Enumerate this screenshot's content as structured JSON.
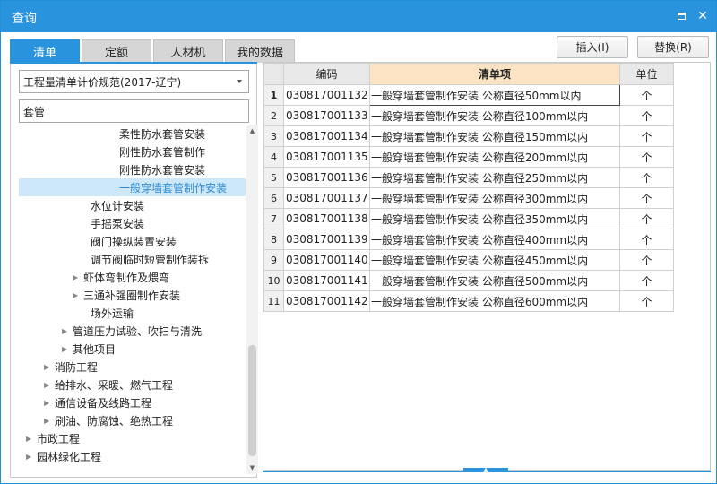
{
  "window": {
    "title": "查询"
  },
  "tabs": [
    {
      "label": "清单",
      "active": true
    },
    {
      "label": "定额",
      "active": false
    },
    {
      "label": "人材机",
      "active": false
    },
    {
      "label": "我的数据",
      "active": false
    }
  ],
  "actions": {
    "insert_label": "插入(I)",
    "replace_label": "替换(R)"
  },
  "left": {
    "spec_select": "工程量清单计价规范(2017-辽宁)",
    "search_value": "套管",
    "tree": [
      {
        "label": "柔性防水套管安装",
        "expandable": false,
        "selected": false
      },
      {
        "label": "刚性防水套管制作",
        "expandable": false,
        "selected": false
      },
      {
        "label": "刚性防水套管安装",
        "expandable": false,
        "selected": false
      },
      {
        "label": "一般穿墙套管制作安装",
        "expandable": false,
        "selected": true
      },
      {
        "label": "水位计安装",
        "expandable": false,
        "selected": false
      },
      {
        "label": "手摇泵安装",
        "expandable": false,
        "selected": false
      },
      {
        "label": "阀门操纵装置安装",
        "expandable": false,
        "selected": false
      },
      {
        "label": "调节阀临时短管制作装拆",
        "expandable": false,
        "selected": false
      },
      {
        "label": "虾体弯制作及煨弯",
        "expandable": true,
        "selected": false
      },
      {
        "label": "三通补强圈制作安装",
        "expandable": true,
        "selected": false
      },
      {
        "label": "场外运输",
        "expandable": false,
        "selected": false
      },
      {
        "label": "管道压力试验、吹扫与清洗",
        "expandable": true,
        "selected": false
      },
      {
        "label": "其他项目",
        "expandable": true,
        "selected": false
      },
      {
        "label": "消防工程",
        "expandable": true,
        "selected": false
      },
      {
        "label": "给排水、采暖、燃气工程",
        "expandable": true,
        "selected": false
      },
      {
        "label": "通信设备及线路工程",
        "expandable": true,
        "selected": false
      },
      {
        "label": "刷油、防腐蚀、绝热工程",
        "expandable": true,
        "selected": false
      },
      {
        "label": "市政工程",
        "expandable": true,
        "selected": false
      },
      {
        "label": "园林绿化工程",
        "expandable": true,
        "selected": false
      }
    ]
  },
  "grid": {
    "headers": {
      "code": "编码",
      "item": "清单项",
      "unit": "单位"
    },
    "rows": [
      {
        "n": "1",
        "code": "030817001132",
        "name": "一般穿墙套管制作安装 公称直径50mm以内",
        "unit": "个"
      },
      {
        "n": "2",
        "code": "030817001133",
        "name": "一般穿墙套管制作安装 公称直径100mm以内",
        "unit": "个"
      },
      {
        "n": "3",
        "code": "030817001134",
        "name": "一般穿墙套管制作安装 公称直径150mm以内",
        "unit": "个"
      },
      {
        "n": "4",
        "code": "030817001135",
        "name": "一般穿墙套管制作安装 公称直径200mm以内",
        "unit": "个"
      },
      {
        "n": "5",
        "code": "030817001136",
        "name": "一般穿墙套管制作安装 公称直径250mm以内",
        "unit": "个"
      },
      {
        "n": "6",
        "code": "030817001137",
        "name": "一般穿墙套管制作安装 公称直径300mm以内",
        "unit": "个"
      },
      {
        "n": "7",
        "code": "030817001138",
        "name": "一般穿墙套管制作安装 公称直径350mm以内",
        "unit": "个"
      },
      {
        "n": "8",
        "code": "030817001139",
        "name": "一般穿墙套管制作安装 公称直径400mm以内",
        "unit": "个"
      },
      {
        "n": "9",
        "code": "030817001140",
        "name": "一般穿墙套管制作安装 公称直径450mm以内",
        "unit": "个"
      },
      {
        "n": "10",
        "code": "030817001141",
        "name": "一般穿墙套管制作安装 公称直径500mm以内",
        "unit": "个"
      },
      {
        "n": "11",
        "code": "030817001142",
        "name": "一般穿墙套管制作安装 公称直径600mm以内",
        "unit": "个"
      }
    ]
  },
  "colors": {
    "accent": "#2a93dd",
    "selected_bg": "#cde8fb",
    "header_highlight": "#fbe3c4"
  }
}
